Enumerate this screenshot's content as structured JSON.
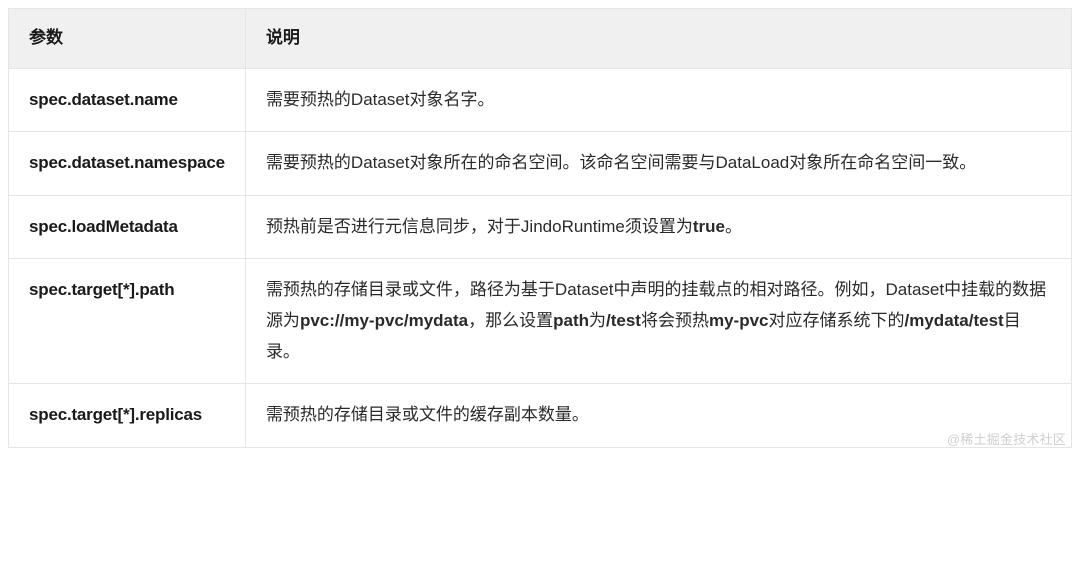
{
  "table": {
    "headers": {
      "param": "参数",
      "desc": "说明"
    },
    "rows": [
      {
        "param": "spec.dataset.name",
        "desc_segments": [
          {
            "t": "需要预热的Dataset对象名字。",
            "b": false
          }
        ]
      },
      {
        "param": "spec.dataset.namespace",
        "desc_segments": [
          {
            "t": "需要预热的Dataset对象所在的命名空间。该命名空间需要与DataLoad对象所在命名空间一致。",
            "b": false
          }
        ]
      },
      {
        "param": "spec.loadMetadata",
        "desc_segments": [
          {
            "t": "预热前是否进行元信息同步，对于JindoRuntime须设置为",
            "b": false
          },
          {
            "t": "true",
            "b": true
          },
          {
            "t": "。",
            "b": false
          }
        ]
      },
      {
        "param": "spec.target[*].path",
        "desc_segments": [
          {
            "t": "需预热的存储目录或文件，路径为基于Dataset中声明的挂载点的相对路径。例如，Dataset中挂载的数据源为",
            "b": false
          },
          {
            "t": "pvc://my-pvc/mydata",
            "b": true
          },
          {
            "t": "，那么设置",
            "b": false
          },
          {
            "t": "path",
            "b": true
          },
          {
            "t": "为",
            "b": false
          },
          {
            "t": "/test",
            "b": true
          },
          {
            "t": "将会预热",
            "b": false
          },
          {
            "t": "my-pvc",
            "b": true
          },
          {
            "t": "对应存储系统下的",
            "b": false
          },
          {
            "t": "/mydata/test",
            "b": true
          },
          {
            "t": "目录。",
            "b": false
          }
        ]
      },
      {
        "param": "spec.target[*].replicas",
        "desc_segments": [
          {
            "t": "需预热的存储目录或文件的缓存副本数量。",
            "b": false
          }
        ]
      }
    ]
  },
  "watermark": "@稀土掘金技术社区"
}
